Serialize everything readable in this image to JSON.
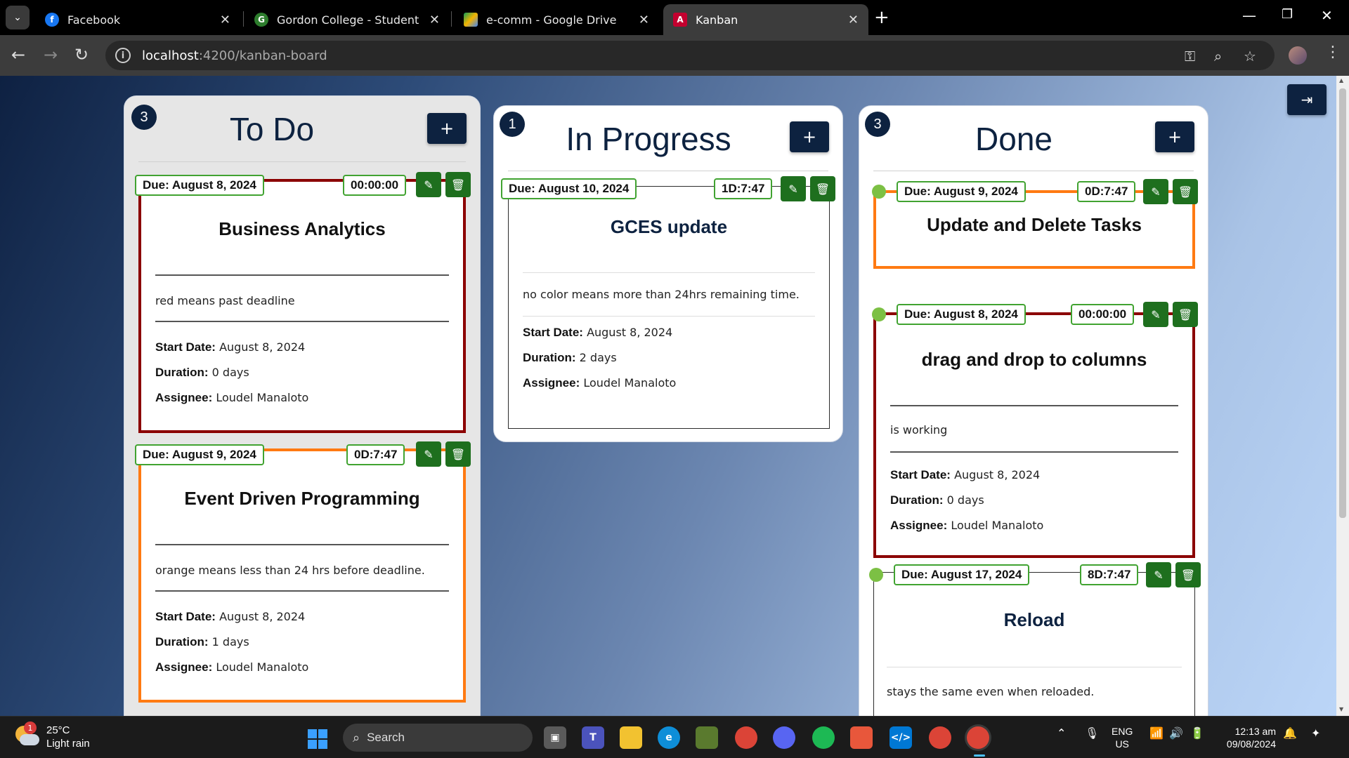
{
  "browser": {
    "tabs": [
      {
        "title": "Facebook",
        "favicon": "facebook-icon",
        "color": "#1877f2"
      },
      {
        "title": "Gordon College - Student",
        "favicon": "gordon-college-icon",
        "color": "#2d7d2d"
      },
      {
        "title": "e-comm - Google Drive",
        "favicon": "google-drive-icon",
        "color": "#f5b400"
      },
      {
        "title": "Kanban",
        "favicon": "angular-icon",
        "color": "#c3002f"
      }
    ],
    "url_host": "localhost",
    "url_path": ":4200/kanban-board"
  },
  "columns": {
    "todo": {
      "title": "To Do",
      "count": "3"
    },
    "progress": {
      "title": "In Progress",
      "count": "1"
    },
    "done": {
      "title": "Done",
      "count": "3"
    }
  },
  "labels": {
    "start": "Start Date:",
    "duration": "Duration:",
    "assignee": "Assignee:"
  },
  "tasks": {
    "t1": {
      "due": "Due: August 8, 2024",
      "timer": "00:00:00",
      "title": "Business Analytics",
      "desc": "red means past deadline",
      "start": "August 8, 2024",
      "duration": "0 days",
      "assignee": "Loudel Manaloto",
      "status_color": "#8b0000"
    },
    "t2": {
      "due": "Due: August 9, 2024",
      "timer": "0D:7:47",
      "title": "Event Driven Programming",
      "desc": "orange means less than 24 hrs before deadline.",
      "start": "August 8, 2024",
      "duration": "1 days",
      "assignee": "Loudel Manaloto",
      "status_color": "#ff7a12"
    },
    "p1": {
      "due": "Due: August 10, 2024",
      "timer": "1D:7:47",
      "title": "GCES update",
      "desc": "no color means more than 24hrs remaining time.",
      "start": "August 8, 2024",
      "duration": "2 days",
      "assignee": "Loudel Manaloto"
    },
    "d1": {
      "due": "Due: August 9, 2024",
      "timer": "0D:7:47",
      "title": "Update and Delete Tasks",
      "status_color": "#ff7a12"
    },
    "d2": {
      "due": "Due: August 8, 2024",
      "timer": "00:00:00",
      "title": "drag and drop to columns",
      "desc": "is working",
      "start": "August 8, 2024",
      "duration": "0 days",
      "assignee": "Loudel Manaloto",
      "status_color": "#8b0000"
    },
    "d3": {
      "due": "Due: August 17, 2024",
      "timer": "8D:7:47",
      "title": "Reload",
      "desc": "stays the same even when reloaded."
    }
  },
  "taskbar": {
    "weather_temp": "25°C",
    "weather_desc": "Light rain",
    "weather_badge": "1",
    "search_label": "Search",
    "lang_1": "ENG",
    "lang_2": "US",
    "time": "12:13 am",
    "date": "09/08/2024"
  },
  "colors": {
    "navy": "#0d2240",
    "green": "#1e6f1e",
    "red_status": "#8b0000",
    "orange_status": "#ff7a12"
  }
}
